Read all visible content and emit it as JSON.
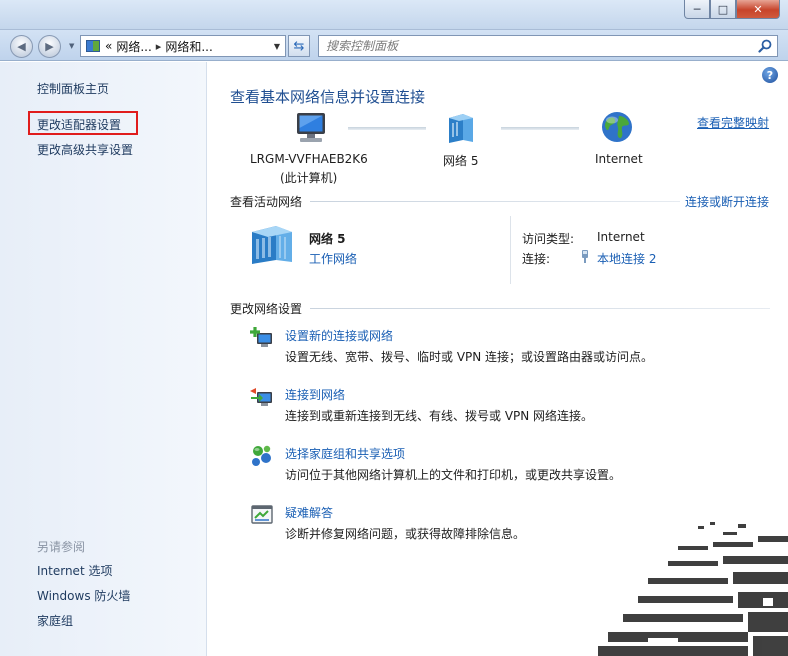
{
  "window": {
    "buttons": {
      "minimize": "─",
      "maximize": "□",
      "close": "✕"
    }
  },
  "navbar": {
    "breadcrumb": [
      "网络...",
      "网络和..."
    ],
    "breadcrumb_prefix": "«",
    "breadcrumb_sep": "▸",
    "search_placeholder": "搜索控制面板"
  },
  "sidebar": {
    "items": [
      {
        "label": "控制面板主页"
      },
      {
        "label": "更改适配器设置"
      },
      {
        "label": "更改高级共享设置"
      }
    ],
    "see_also_heading": "另请参阅",
    "see_also": [
      {
        "label": "Internet 选项"
      },
      {
        "label": "Windows 防火墙"
      },
      {
        "label": "家庭组"
      }
    ]
  },
  "main": {
    "title": "查看基本网络信息并设置连接",
    "full_map_link": "查看完整映射",
    "network_map": {
      "computer_name": "LRGM-VVFHAEB2K6",
      "computer_sub": "(此计算机)",
      "network_name": "网络  5",
      "internet": "Internet"
    },
    "active_networks": {
      "heading": "查看活动网络",
      "connect_link": "连接或断开连接",
      "network_name": "网络  5",
      "network_type": "工作网络",
      "access_type_label": "访问类型:",
      "access_type_value": "Internet",
      "connections_label": "连接:",
      "connections_value": "本地连接 2"
    },
    "change_settings": {
      "heading": "更改网络设置",
      "tasks": [
        {
          "link": "设置新的连接或网络",
          "desc": "设置无线、宽带、拨号、临时或 VPN 连接；或设置路由器或访问点。"
        },
        {
          "link": "连接到网络",
          "desc": "连接到或重新连接到无线、有线、拨号或 VPN 网络连接。"
        },
        {
          "link": "选择家庭组和共享选项",
          "desc": "访问位于其他网络计算机上的文件和打印机，或更改共享设置。"
        },
        {
          "link": "疑难解答",
          "desc": "诊断并修复网络问题，或获得故障排除信息。"
        }
      ]
    }
  },
  "colors": {
    "link": "#1a5fb4",
    "title": "#1f4e91",
    "highlight_box": "#e01c1c"
  }
}
